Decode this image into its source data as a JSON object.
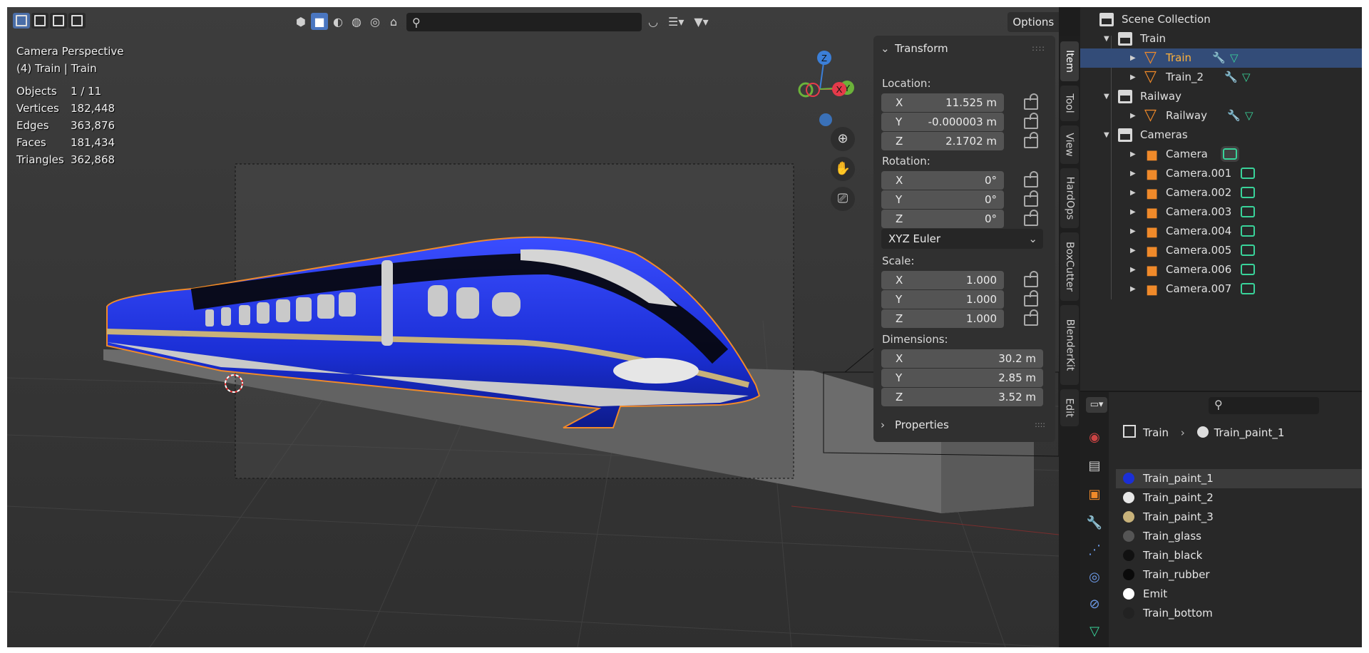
{
  "viewport": {
    "overlay_title": "Camera Perspective",
    "overlay_object": "(4) Train | Train",
    "stats": [
      {
        "label": "Objects",
        "value": "1 / 11"
      },
      {
        "label": "Vertices",
        "value": "182,448"
      },
      {
        "label": "Edges",
        "value": "363,876"
      },
      {
        "label": "Faces",
        "value": "181,434"
      },
      {
        "label": "Triangles",
        "value": "362,868"
      }
    ],
    "options_label": "Options",
    "gizmo": {
      "x": "X",
      "y": "Y",
      "z": "Z"
    }
  },
  "transform_panel": {
    "title": "Transform",
    "location_label": "Location:",
    "location": [
      {
        "axis": "X",
        "value": "11.525 m"
      },
      {
        "axis": "Y",
        "value": "-0.000003 m"
      },
      {
        "axis": "Z",
        "value": "2.1702 m"
      }
    ],
    "rotation_label": "Rotation:",
    "rotation": [
      {
        "axis": "X",
        "value": "0°"
      },
      {
        "axis": "Y",
        "value": "0°"
      },
      {
        "axis": "Z",
        "value": "0°"
      }
    ],
    "rotation_mode": "XYZ Euler",
    "scale_label": "Scale:",
    "scale": [
      {
        "axis": "X",
        "value": "1.000"
      },
      {
        "axis": "Y",
        "value": "1.000"
      },
      {
        "axis": "Z",
        "value": "1.000"
      }
    ],
    "dimensions_label": "Dimensions:",
    "dimensions": [
      {
        "axis": "X",
        "value": "30.2 m"
      },
      {
        "axis": "Y",
        "value": "2.85 m"
      },
      {
        "axis": "Z",
        "value": "3.52 m"
      }
    ],
    "properties_label": "Properties"
  },
  "sidebar_tabs": [
    "Item",
    "Tool",
    "View",
    "HardOps",
    "BoxCutter",
    "BlenderKit",
    "Edit"
  ],
  "outliner": {
    "root": "Scene Collection",
    "collections": [
      {
        "name": "Train",
        "objects": [
          {
            "name": "Train",
            "type": "mesh",
            "selected": true
          },
          {
            "name": "Train_2",
            "type": "mesh",
            "selected": false
          }
        ]
      },
      {
        "name": "Railway",
        "objects": [
          {
            "name": "Railway",
            "type": "mesh",
            "selected": false
          }
        ]
      },
      {
        "name": "Cameras",
        "objects": [
          {
            "name": "Camera",
            "type": "camera",
            "active": true
          },
          {
            "name": "Camera.001",
            "type": "camera"
          },
          {
            "name": "Camera.002",
            "type": "camera"
          },
          {
            "name": "Camera.003",
            "type": "camera"
          },
          {
            "name": "Camera.004",
            "type": "camera"
          },
          {
            "name": "Camera.005",
            "type": "camera"
          },
          {
            "name": "Camera.006",
            "type": "camera"
          },
          {
            "name": "Camera.007",
            "type": "camera"
          }
        ]
      }
    ]
  },
  "properties": {
    "breadcrumb_object": "Train",
    "breadcrumb_material": "Train_paint_1",
    "materials": [
      {
        "name": "Train_paint_1",
        "color": "#1b2fd6"
      },
      {
        "name": "Train_paint_2",
        "color": "#e8e8e8"
      },
      {
        "name": "Train_paint_3",
        "color": "#c8b27a"
      },
      {
        "name": "Train_glass",
        "color": "#555555"
      },
      {
        "name": "Train_black",
        "color": "#111111"
      },
      {
        "name": "Train_rubber",
        "color": "#0a0a0a"
      },
      {
        "name": "Emit",
        "color": "#ffffff"
      },
      {
        "name": "Train_bottom",
        "color": "#222222"
      }
    ],
    "selected_material": "Train_paint_1"
  },
  "colors": {
    "accent": "#4a76c0",
    "selection_outline": "#f08a2a",
    "train_blue": "#1b2fd6",
    "outliner_selected": "#334c78"
  }
}
